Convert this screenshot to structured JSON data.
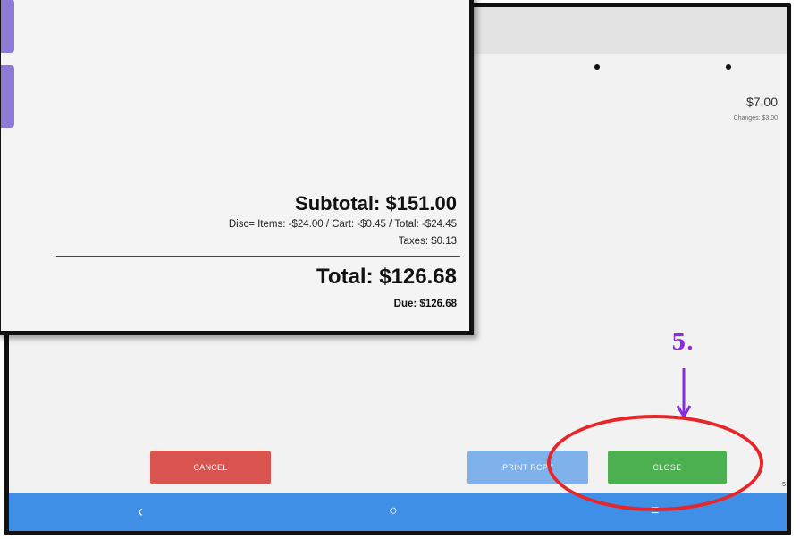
{
  "overlay": {
    "subtotal": "Subtotal: $151.00",
    "discounts": "Disc= Items: -$24.00 / Cart: -$0.45 / Total: -$24.45",
    "taxes": "Taxes: $0.13",
    "total": "Total: $126.68",
    "due": "Due: $126.68"
  },
  "background": {
    "amount": "$7.00",
    "changes": "Changes: $3.00",
    "buttons": {
      "cancel": "CANCEL",
      "print_receipt": "PRINT RCPT",
      "close": "CLOSE"
    },
    "side_tag": "5"
  },
  "annotation": {
    "step": "5.",
    "highlight_color": "#e8262a",
    "step_color": "#8a2be2"
  },
  "colors": {
    "cancel": "#d9534f",
    "print_receipt": "#7fb2ea",
    "close": "#4caf50",
    "navbar": "#3f8fe6",
    "tab": "#8c7ad6"
  },
  "icons": {
    "nav_back": "‹",
    "nav_home": "○",
    "nav_menu": "≡"
  }
}
